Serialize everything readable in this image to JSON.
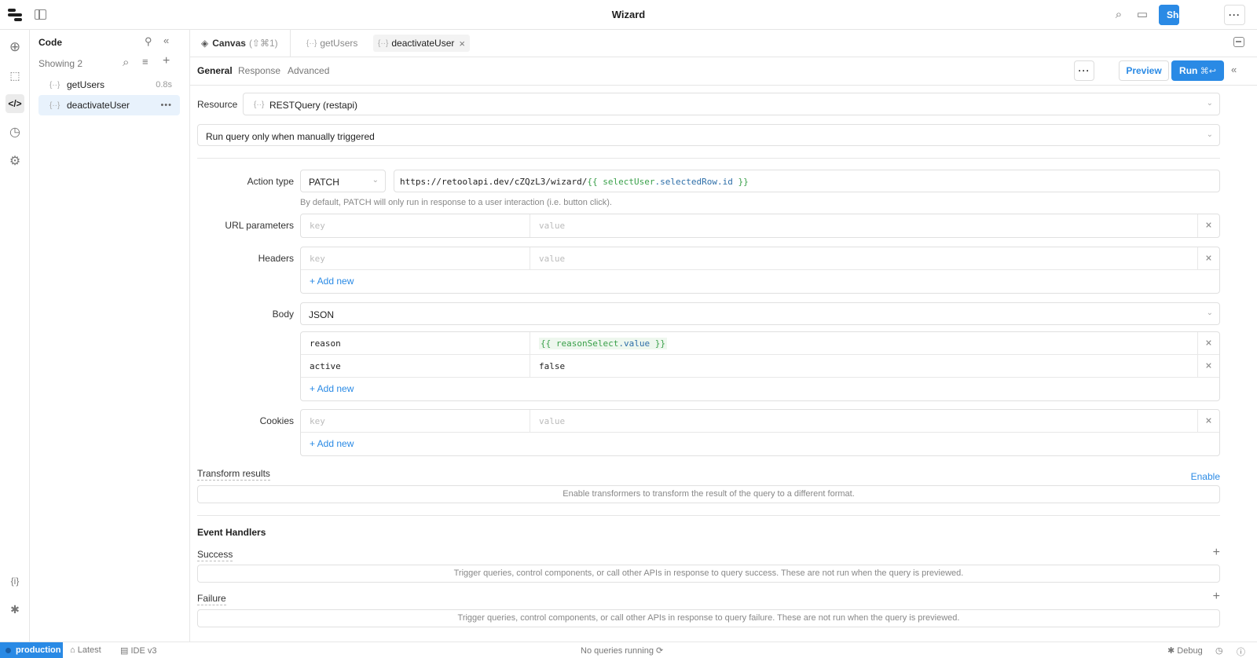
{
  "app": {
    "title": "Wizard"
  },
  "topbar": {
    "share_label": "Share"
  },
  "code_panel": {
    "title": "Code",
    "showing": "Showing 2",
    "queries": [
      {
        "name": "getUsers",
        "meta": "0.8s",
        "selected": false
      },
      {
        "name": "deactivateUser",
        "meta": "•••",
        "selected": true
      }
    ]
  },
  "tabs": [
    {
      "label": "Canvas",
      "shortcut": "(⇧⌘1)"
    },
    {
      "label": "getUsers"
    },
    {
      "label": "deactivateUser",
      "active": true
    }
  ],
  "subtabs": [
    "General",
    "Response",
    "Advanced"
  ],
  "actions": {
    "preview": "Preview",
    "run": "Run",
    "run_shortcut": "⌘↩"
  },
  "form": {
    "resource_label": "Resource",
    "resource_value": "RESTQuery (restapi)",
    "trigger_value": "Run query only when manually triggered",
    "action_type_label": "Action type",
    "action_type_value": "PATCH",
    "url_prefix": "https://retoolapi.dev/cZQzL3/wizard/",
    "url_open": "{{",
    "url_var": "selectUser",
    "url_rest": ".selectedRow.id",
    "url_close": "}}",
    "action_hint": "By default, PATCH will only run in response to a user interaction (i.e. button click).",
    "url_params_label": "URL parameters",
    "headers_label": "Headers",
    "body_label": "Body",
    "body_type": "JSON",
    "cookies_label": "Cookies",
    "key_placeholder": "key",
    "value_placeholder": "value",
    "add_new": "+ Add new",
    "body_rows": [
      {
        "key": "reason",
        "value_open": "{{",
        "value_var": "reasonSelect",
        "value_rest": ".value",
        "value_close": "}}"
      },
      {
        "key": "active",
        "value": "false"
      }
    ]
  },
  "transform": {
    "label": "Transform results",
    "enable": "Enable",
    "placeholder": "Enable transformers to transform the result of the query to a different format."
  },
  "events": {
    "title": "Event Handlers",
    "success_label": "Success",
    "success_placeholder": "Trigger queries, control components, or call other APIs in response to query success. These are not run when the query is previewed.",
    "failure_label": "Failure",
    "failure_placeholder": "Trigger queries, control components, or call other APIs in response to query failure. These are not run when the query is previewed."
  },
  "statusbar": {
    "env": "production",
    "version": "Latest",
    "ide": "IDE v3",
    "running": "No queries running",
    "debug": "Debug"
  }
}
